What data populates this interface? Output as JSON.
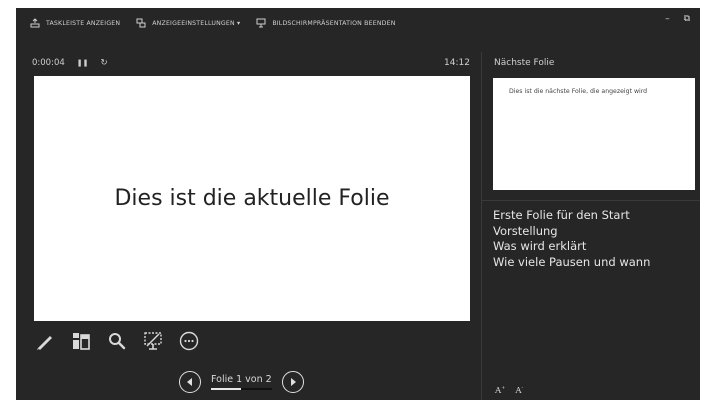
{
  "toolbar": {
    "taskbar_label": "TASKLEISTE ANZEIGEN",
    "display_settings_label": "ANZEIGEEINSTELLUNGEN ▾",
    "end_show_label": "BILDSCHIRMPRÄSENTATION BEENDEN",
    "minimize_glyph": "–",
    "restore_glyph": "⧉"
  },
  "presenter": {
    "elapsed_time": "0:00:04",
    "pause_glyph": "❚❚",
    "reset_glyph": "↻",
    "clock": "14:12"
  },
  "current_slide": {
    "text": "Dies ist die aktuelle Folie"
  },
  "next_slide": {
    "heading": "Nächste Folie",
    "text": "Dies ist die nächste Folie, die angezeigt wird"
  },
  "notes": [
    "Erste Folie für den Start",
    "Vorstellung",
    "Was wird erklärt",
    "Wie viele Pausen und wann"
  ],
  "navigation": {
    "counter": "Folie 1 von 2",
    "progress_fraction": 0.5
  },
  "text_size": {
    "increase_label": "A",
    "decrease_label": "A"
  },
  "icons": {
    "pen": "pen-icon",
    "all_slides": "all-slides-icon",
    "zoom": "zoom-icon",
    "black_screen": "black-screen-icon",
    "more": "more-options-icon",
    "prev": "previous-slide-icon",
    "next": "next-slide-icon"
  },
  "colors": {
    "background": "#262626",
    "slide": "#ffffff",
    "text": "#d9d9d9"
  }
}
